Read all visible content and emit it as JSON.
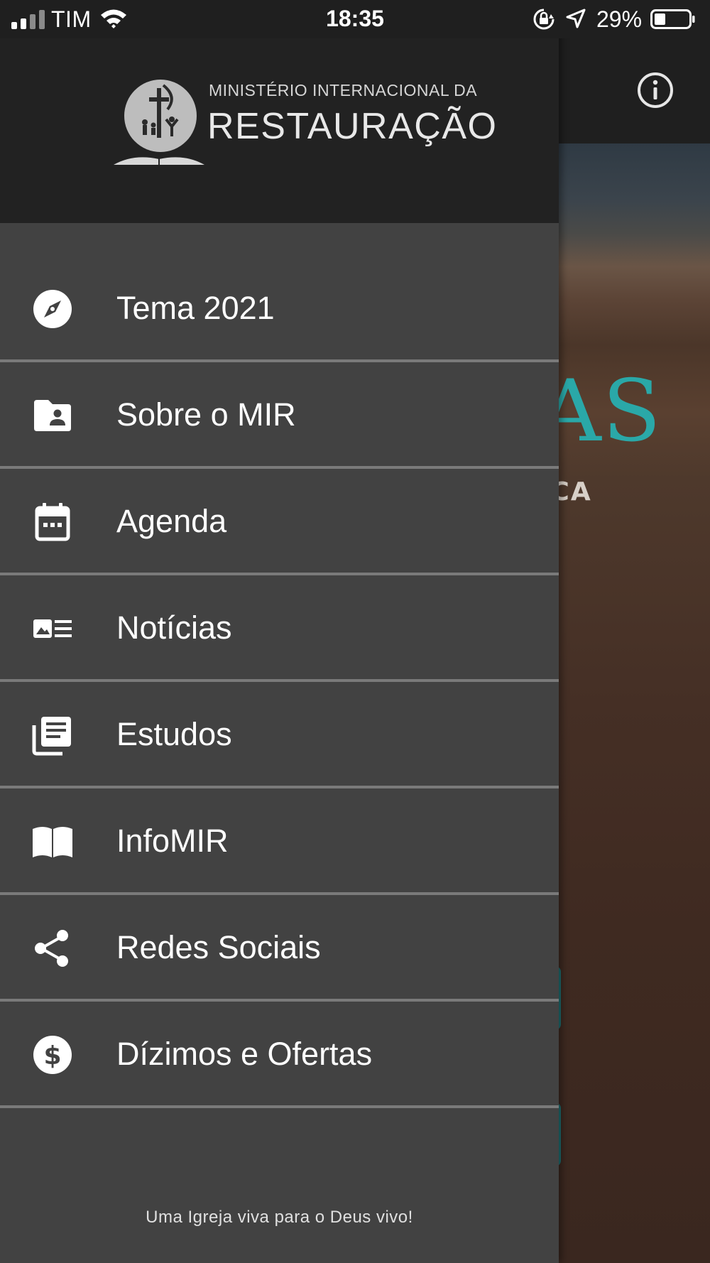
{
  "status_bar": {
    "carrier": "TIM",
    "time": "18:35",
    "battery_percent": "29%",
    "icons": [
      "signal-icon",
      "wifi-icon",
      "orientation-lock-icon",
      "location-icon",
      "battery-icon"
    ]
  },
  "drawer": {
    "logo": {
      "line1": "MINISTÉRIO INTERNACIONAL DA",
      "line2": "RESTAURAÇÃO"
    },
    "items": [
      {
        "label": "Tema 2021",
        "icon": "compass-icon"
      },
      {
        "label": "Sobre o MIR",
        "icon": "folder-user-icon"
      },
      {
        "label": "Agenda",
        "icon": "calendar-icon"
      },
      {
        "label": "Notícias",
        "icon": "news-icon"
      },
      {
        "label": "Estudos",
        "icon": "library-books-icon"
      },
      {
        "label": "InfoMIR",
        "icon": "open-book-icon"
      },
      {
        "label": "Redes Sociais",
        "icon": "share-icon"
      },
      {
        "label": "Dízimos e Ofertas",
        "icon": "dollar-circle-icon"
      }
    ],
    "tagline": "Uma Igreja viva para o Deus vivo!"
  },
  "background": {
    "hero_text_partial": "AS",
    "hero_subtext_partial": "ICA",
    "info_icon": "info-icon"
  },
  "colors": {
    "drawer_bg": "#424242",
    "drawer_header_bg": "#222222",
    "divider": "#7a7a7a",
    "hero_accent": "#2aa8a8"
  }
}
